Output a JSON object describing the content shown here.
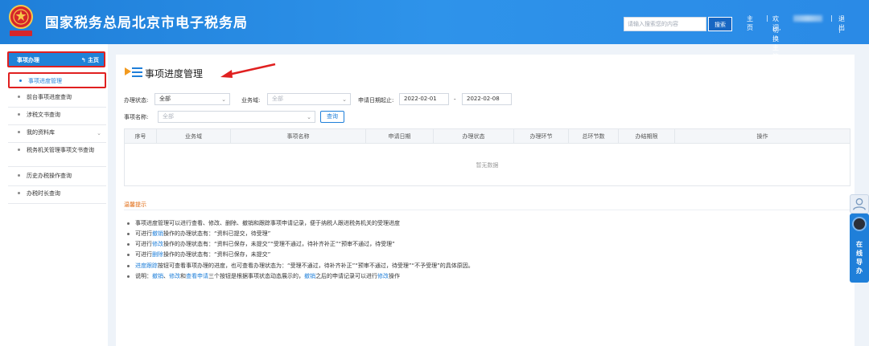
{
  "header": {
    "site_title": "国家税务总局北京市电子税务局",
    "emblem_text": "中国税务",
    "search_placeholder": "请输入搜索您的内容",
    "search_button": "搜索",
    "home_link": "主页",
    "separator": "|",
    "welcome": "欢迎,",
    "logout": "退出",
    "switch_authority": "切换主管税务机关"
  },
  "sidebar": {
    "head_label": "事项办理",
    "head_home": "主页",
    "items": [
      {
        "label": "事项进度管理",
        "active": true
      },
      {
        "label": "前台事项进度查询"
      },
      {
        "label": "涉税文书查询"
      },
      {
        "label": "我的资料库",
        "has_chevron": true
      },
      {
        "label": "税务机关管理事项文书查询"
      },
      {
        "label": "历史办税操作查询"
      },
      {
        "label": "办税时长查询"
      }
    ]
  },
  "main": {
    "title": "事项进度管理",
    "filters": {
      "status_label": "办理状态:",
      "status_value": "全部",
      "business_label": "业务域:",
      "business_value": "全部",
      "date_label": "申请日期起止:",
      "date_from": "2022-02-01",
      "date_sep": "-",
      "date_to": "2022-02-08",
      "item_name_label": "事项名称:",
      "item_name_value": "全部",
      "query_button": "查询"
    },
    "table": {
      "columns": [
        "序号",
        "业务域",
        "事项名称",
        "申请日期",
        "办理状态",
        "办理环节",
        "总环节数",
        "办结期限",
        "操作"
      ],
      "empty_text": "暂无数据"
    },
    "tips": {
      "title": "温馨提示",
      "items": [
        {
          "parts": [
            {
              "t": "事项进度管理可以进行查看、修改、删除、撤销和跟踪事项申请记录，便于纳税人跟进税务机关的受理进度"
            }
          ]
        },
        {
          "parts": [
            {
              "t": "可进行"
            },
            {
              "t": "撤销",
              "link": true
            },
            {
              "t": "操作的办理状态有：“资料已提交，待受理”"
            }
          ]
        },
        {
          "parts": [
            {
              "t": "可进行"
            },
            {
              "t": "修改",
              "link": true
            },
            {
              "t": "操作的办理状态有：“资料已保存，未提交”“受理不通过，待补齐补正”“预审不通过，待受理”"
            }
          ]
        },
        {
          "parts": [
            {
              "t": "可进行"
            },
            {
              "t": "删除",
              "link": true
            },
            {
              "t": "操作的办理状态有：“资料已保存，未提交”"
            }
          ]
        },
        {
          "parts": [
            {
              "t": "进度跟踪",
              "link": true
            },
            {
              "t": "按钮可查看事项办理的进度，也可查看办理状态为：“受理不通过，待补齐补正”“预审不通过，待受理”“不予受理”的具体原因。"
            }
          ]
        },
        {
          "parts": [
            {
              "t": "说明："
            },
            {
              "t": "撤销",
              "link": true
            },
            {
              "t": "、"
            },
            {
              "t": "修改",
              "link": true
            },
            {
              "t": "和"
            },
            {
              "t": "查看申请",
              "link": true
            },
            {
              "t": "三个按钮是根据事项状态动态展示的，"
            },
            {
              "t": "撤销",
              "link": true
            },
            {
              "t": "之后的申请记录可以进行"
            },
            {
              "t": "修改",
              "link": true
            },
            {
              "t": "操作"
            }
          ]
        }
      ]
    }
  },
  "float_widget": {
    "label": "在线导办"
  },
  "colors": {
    "header_blue": "#2a8ae6",
    "accent_blue": "#1f7fd9",
    "highlight_red": "#e02020",
    "tips_orange": "#e06a10"
  },
  "icons": [
    "emblem-icon",
    "home-arrow-icon",
    "list-title-icon",
    "chevron-down-icon",
    "annotation-arrow-icon",
    "user-icon",
    "assistant-avatar-icon"
  ]
}
